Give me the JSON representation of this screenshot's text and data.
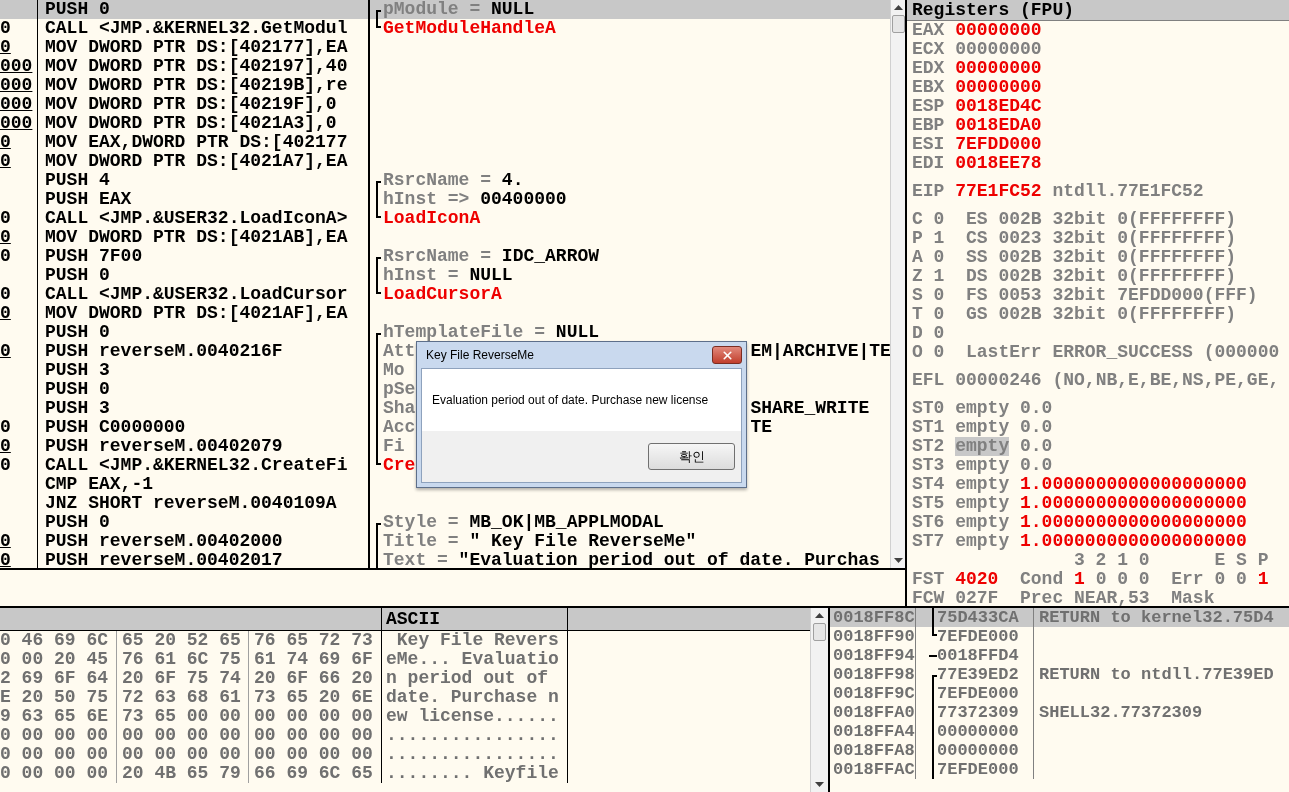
{
  "disassembly": {
    "rows": [
      {
        "bytes": "",
        "instruction": "PUSH 0",
        "selected": true
      },
      {
        "bytes": "0",
        "underlined": false,
        "instruction": "CALL <JMP.&KERNEL32.GetModul",
        "selected": false
      },
      {
        "bytes": "0",
        "underlined": true,
        "instruction": "MOV DWORD PTR DS:[402177],EA",
        "selected": false
      },
      {
        "bytes": "000",
        "underlined": true,
        "instruction": "MOV DWORD PTR DS:[402197],40",
        "selected": false
      },
      {
        "bytes": "000",
        "underlined": true,
        "instruction": "MOV DWORD PTR DS:[40219B],re",
        "selected": false
      },
      {
        "bytes": "000",
        "underlined": true,
        "instruction": "MOV DWORD PTR DS:[40219F],0",
        "selected": false
      },
      {
        "bytes": "000",
        "underlined": true,
        "instruction": "MOV DWORD PTR DS:[4021A3],0",
        "selected": false
      },
      {
        "bytes": "0",
        "underlined": true,
        "instruction": "MOV EAX,DWORD PTR DS:[402177",
        "selected": false
      },
      {
        "bytes": "0",
        "underlined": true,
        "instruction": "MOV DWORD PTR DS:[4021A7],EA",
        "selected": false
      },
      {
        "bytes": "",
        "instruction": "PUSH 4",
        "selected": false
      },
      {
        "bytes": "",
        "instruction": "PUSH EAX",
        "selected": false
      },
      {
        "bytes": "0",
        "underlined": false,
        "instruction": "CALL <JMP.&USER32.LoadIconA>",
        "selected": false
      },
      {
        "bytes": "0",
        "underlined": true,
        "instruction": "MOV DWORD PTR DS:[4021AB],EA",
        "selected": false
      },
      {
        "bytes": "0",
        "underlined": false,
        "instruction": "PUSH 7F00",
        "selected": false
      },
      {
        "bytes": "",
        "instruction": "PUSH 0",
        "selected": false
      },
      {
        "bytes": "0",
        "underlined": false,
        "instruction": "CALL <JMP.&USER32.LoadCursor",
        "selected": false
      },
      {
        "bytes": "0",
        "underlined": true,
        "instruction": "MOV DWORD PTR DS:[4021AF],EA",
        "selected": false
      },
      {
        "bytes": "",
        "instruction": "PUSH 0",
        "selected": false
      },
      {
        "bytes": "0",
        "underlined": true,
        "instruction": "PUSH reverseM.0040216F",
        "selected": false
      },
      {
        "bytes": "",
        "instruction": "PUSH 3",
        "selected": false
      },
      {
        "bytes": "",
        "instruction": "PUSH 0",
        "selected": false
      },
      {
        "bytes": "",
        "instruction": "PUSH 3",
        "selected": false
      },
      {
        "bytes": "0",
        "underlined": false,
        "instruction": "PUSH C0000000",
        "selected": false
      },
      {
        "bytes": "0",
        "underlined": true,
        "instruction": "PUSH reverseM.00402079",
        "selected": false
      },
      {
        "bytes": "0",
        "underlined": false,
        "instruction": "CALL <JMP.&KERNEL32.CreateFi",
        "selected": false
      },
      {
        "bytes": "",
        "instruction": "CMP EAX,-1",
        "selected": false
      },
      {
        "bytes": "",
        "instruction": "JNZ SHORT reverseM.0040109A",
        "selected": false
      },
      {
        "bytes": "",
        "instruction": "PUSH 0",
        "selected": false
      },
      {
        "bytes": "0",
        "underlined": true,
        "instruction": "PUSH reverseM.00402000",
        "selected": false
      },
      {
        "bytes": "0",
        "underlined": true,
        "instruction": "PUSH reverseM.00402017",
        "selected": false
      }
    ]
  },
  "comments": {
    "rows": [
      {
        "kind": "param",
        "bracket": {
          "kind": "start"
        },
        "label": "pModule =",
        "value": "NULL"
      },
      {
        "kind": "function",
        "bracket": {
          "kind": "end"
        },
        "text": "GetModuleHandleA"
      },
      {
        "kind": "blank"
      },
      {
        "kind": "blank"
      },
      {
        "kind": "blank"
      },
      {
        "kind": "blank"
      },
      {
        "kind": "blank"
      },
      {
        "kind": "blank"
      },
      {
        "kind": "blank"
      },
      {
        "kind": "param",
        "bracket": {
          "kind": "start"
        },
        "label": "RsrcName =",
        "value": "4."
      },
      {
        "kind": "param",
        "bracket": {
          "kind": "mid"
        },
        "label": "hInst =>",
        "value": "00400000"
      },
      {
        "kind": "function",
        "bracket": {
          "kind": "end"
        },
        "text": "LoadIconA"
      },
      {
        "kind": "blank"
      },
      {
        "kind": "param",
        "bracket": {
          "kind": "start"
        },
        "label": "RsrcName =",
        "value": "IDC_ARROW"
      },
      {
        "kind": "param",
        "bracket": {
          "kind": "mid"
        },
        "label": "hInst =",
        "value": "NULL"
      },
      {
        "kind": "function",
        "bracket": {
          "kind": "end"
        },
        "text": "LoadCursorA"
      },
      {
        "kind": "blank"
      },
      {
        "kind": "param",
        "bracket": {
          "kind": "start"
        },
        "label": "hTemplateFile =",
        "value": "NULL"
      },
      {
        "kind": "param",
        "bracket": {
          "kind": "mid"
        },
        "label": "Att",
        "right": "EM|ARCHIVE|TE"
      },
      {
        "kind": "param",
        "bracket": {
          "kind": "mid"
        },
        "label": "Mo"
      },
      {
        "kind": "param",
        "bracket": {
          "kind": "mid"
        },
        "label": "pSe"
      },
      {
        "kind": "param",
        "bracket": {
          "kind": "mid"
        },
        "label": "Sha",
        "right": "SHARE_WRITE"
      },
      {
        "kind": "param",
        "bracket": {
          "kind": "mid"
        },
        "label": "Acc",
        "right": "TE"
      },
      {
        "kind": "param",
        "bracket": {
          "kind": "mid"
        },
        "label": "Fi"
      },
      {
        "kind": "function",
        "bracket": {
          "kind": "end"
        },
        "text": "Cre"
      },
      {
        "kind": "blank"
      },
      {
        "kind": "blank"
      },
      {
        "kind": "param",
        "bracket": {
          "kind": "start"
        },
        "label": "Style =",
        "value": "MB_OK|MB_APPLMODAL"
      },
      {
        "kind": "param",
        "bracket": {
          "kind": "mid"
        },
        "label": "Title =",
        "value": "\" Key File ReverseMe\""
      },
      {
        "kind": "param",
        "bracket": {
          "kind": "mid"
        },
        "label": "Text =",
        "value": "\"Evaluation period out of date. Purchas"
      }
    ]
  },
  "registers": {
    "title": "Registers (FPU)",
    "general": [
      {
        "name": "EAX",
        "value": "00000000",
        "changed": true
      },
      {
        "name": "ECX",
        "value": "00000000",
        "changed": false
      },
      {
        "name": "EDX",
        "value": "00000000",
        "changed": true
      },
      {
        "name": "EBX",
        "value": "00000000",
        "changed": true
      },
      {
        "name": "ESP",
        "value": "0018ED4C",
        "changed": true
      },
      {
        "name": "EBP",
        "value": "0018EDA0",
        "changed": true
      },
      {
        "name": "ESI",
        "value": "7EFDD000",
        "changed": true
      },
      {
        "name": "EDI",
        "value": "0018EE78",
        "changed": true
      }
    ],
    "eip": {
      "name": "EIP",
      "value": "77E1FC52",
      "changed": true,
      "comment": "ntdll.77E1FC52"
    },
    "flags": [
      {
        "flag": "C 0",
        "segment": "ES 002B 32bit 0(FFFFFFFF)"
      },
      {
        "flag": "P 1",
        "segment": "CS 0023 32bit 0(FFFFFFFF)"
      },
      {
        "flag": "A 0",
        "segment": "SS 002B 32bit 0(FFFFFFFF)"
      },
      {
        "flag": "Z 1",
        "segment": "DS 002B 32bit 0(FFFFFFFF)"
      },
      {
        "flag": "S 0",
        "segment": "FS 0053 32bit 7EFDD000(FFF)"
      },
      {
        "flag": "T 0",
        "segment": "GS 002B 32bit 0(FFFFFFFF)"
      },
      {
        "flag": "D 0"
      },
      {
        "flag": "O 0",
        "segment": "LastErr ERROR_SUCCESS (000000"
      }
    ],
    "efl": {
      "name": "EFL",
      "value": "00000246",
      "changed": false,
      "comment": "(NO,NB,E,BE,NS,PE,GE,"
    },
    "fpu": [
      {
        "name": "ST0",
        "tag": "empty",
        "value": "0.0",
        "changed": false,
        "selected": false
      },
      {
        "name": "ST1",
        "tag": "empty",
        "value": "0.0",
        "changed": false,
        "selected": false
      },
      {
        "name": "ST2",
        "tag": "empty",
        "value": "0.0",
        "changed": false,
        "selected": true
      },
      {
        "name": "ST3",
        "tag": "empty",
        "value": "0.0",
        "changed": false,
        "selected": false
      },
      {
        "name": "ST4",
        "tag": "empty",
        "value": "1.0000000000000000000",
        "changed": true,
        "selected": false
      },
      {
        "name": "ST5",
        "tag": "empty",
        "value": "1.0000000000000000000",
        "changed": true,
        "selected": false
      },
      {
        "name": "ST6",
        "tag": "empty",
        "value": "1.0000000000000000000",
        "changed": true,
        "selected": false
      },
      {
        "name": "ST7",
        "tag": "empty",
        "value": "1.0000000000000000000",
        "changed": true,
        "selected": false
      }
    ],
    "fpu_status": [
      {
        "segments": [
          {
            "text": "3 2 1 0",
            "changed": false
          },
          {
            "text": "E S P",
            "changed": false
          }
        ]
      },
      {
        "segments": [
          {
            "text": "FST",
            "changed": false
          },
          {
            "text": "4020",
            "changed": true
          },
          {
            "text": "Cond",
            "changed": false
          },
          {
            "text": "1",
            "changed": true
          },
          {
            "text": "0 0 0",
            "changed": false
          },
          {
            "text": "Err",
            "changed": false
          },
          {
            "text": "0 0",
            "changed": false
          },
          {
            "text": "1",
            "changed": true
          }
        ]
      },
      {
        "segments": [
          {
            "text": "FCW",
            "changed": false
          },
          {
            "text": "027F",
            "changed": false
          },
          {
            "text": "Prec",
            "changed": false
          },
          {
            "text": "NEAR,53",
            "changed": false
          },
          {
            "text": "Mask",
            "changed": false
          }
        ]
      }
    ]
  },
  "dump": {
    "header": "ASCII",
    "rows": [
      {
        "hex": [
          "0 46 69 6C",
          "65 20 52 65",
          "76 65 72 73"
        ],
        "ascii": " Key File Revers"
      },
      {
        "hex": [
          "0 00 20 45",
          "76 61 6C 75",
          "61 74 69 6F"
        ],
        "ascii": "eMe... Evaluatio"
      },
      {
        "hex": [
          "2 69 6F 64",
          "20 6F 75 74",
          "20 6F 66 20"
        ],
        "ascii": "n period out of"
      },
      {
        "hex": [
          "E 20 50 75",
          "72 63 68 61",
          "73 65 20 6E"
        ],
        "ascii": "date. Purchase n"
      },
      {
        "hex": [
          "9 63 65 6E",
          "73 65 00 00",
          "00 00 00 00"
        ],
        "ascii": "ew license......"
      },
      {
        "hex": [
          "0 00 00 00",
          "00 00 00 00",
          "00 00 00 00"
        ],
        "ascii": "................"
      },
      {
        "hex": [
          "0 00 00 00",
          "00 00 00 00",
          "00 00 00 00"
        ],
        "ascii": "................"
      },
      {
        "hex": [
          "0 00 00 00",
          "20 4B 65 79",
          "66 69 6C 65"
        ],
        "ascii": "........ Keyfile"
      }
    ]
  },
  "stack": {
    "rows": [
      {
        "address": "0018FF8C",
        "value": "75D433CA",
        "comment": "RETURN to kernel32.75D4",
        "bracket": {
          "kind": "mid"
        },
        "selected": true
      },
      {
        "address": "0018FF90",
        "value": "7EFDE000",
        "bracket": {
          "kind": "end"
        },
        "selected": false
      },
      {
        "address": "0018FF94",
        "value": "0018FFD4",
        "bracket": {
          "kind": "link"
        },
        "selected": false
      },
      {
        "address": "0018FF98",
        "value": "77E39ED2",
        "comment": "RETURN to ntdll.77E39ED",
        "bracket": {
          "kind": "start"
        },
        "selected": false
      },
      {
        "address": "0018FF9C",
        "value": "7EFDE000",
        "bracket": {
          "kind": "mid"
        },
        "selected": false
      },
      {
        "address": "0018FFA0",
        "value": "77372309",
        "comment": "SHELL32.77372309",
        "bracket": {
          "kind": "mid"
        },
        "selected": false
      },
      {
        "address": "0018FFA4",
        "value": "00000000",
        "bracket": {
          "kind": "mid"
        },
        "selected": false
      },
      {
        "address": "0018FFA8",
        "value": "00000000",
        "bracket": {
          "kind": "mid"
        },
        "selected": false
      },
      {
        "address": "0018FFAC",
        "value": "7EFDE000",
        "bracket": {
          "kind": "mid"
        },
        "selected": false
      }
    ]
  },
  "dialog": {
    "title": "Key File ReverseMe",
    "message": "Evaluation period out of date. Purchase new license",
    "button": "확인"
  }
}
